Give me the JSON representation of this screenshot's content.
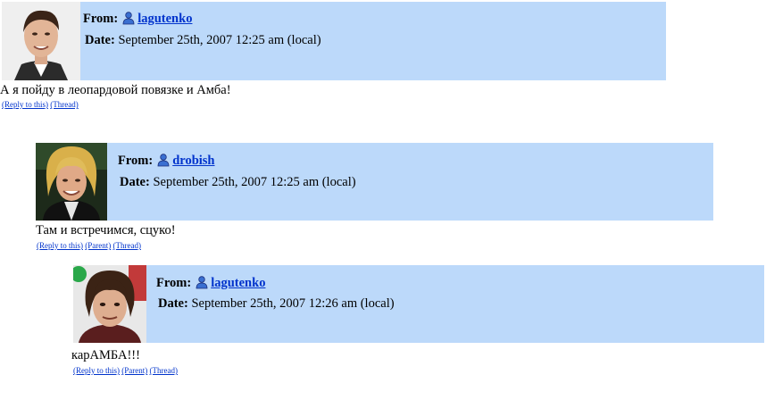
{
  "comments": [
    {
      "from_label": "From:",
      "username": "lagutenko",
      "date_label": "Date:",
      "date": "September 25th, 2007 12:25 am (local)",
      "text": "А я пойду в леопардовой повязке и Амба!",
      "links": {
        "reply": "(Reply to this)",
        "thread": "(Thread)"
      }
    },
    {
      "from_label": "From:",
      "username": "drobish",
      "date_label": "Date:",
      "date": "September 25th, 2007 12:25 am (local)",
      "text": "Там и встречимся, сцуко!",
      "links": {
        "reply": "(Reply to this)",
        "parent": "(Parent)",
        "thread": "(Thread)"
      }
    },
    {
      "from_label": "From:",
      "username": "lagutenko",
      "date_label": "Date:",
      "date": "September 25th, 2007 12:26 am (local)",
      "text": "карАМБА!!!",
      "links": {
        "reply": "(Reply to this)",
        "parent": "(Parent)",
        "thread": "(Thread)"
      }
    }
  ],
  "colors": {
    "header_bg": "#bcd9fa",
    "link": "#0033cc"
  }
}
